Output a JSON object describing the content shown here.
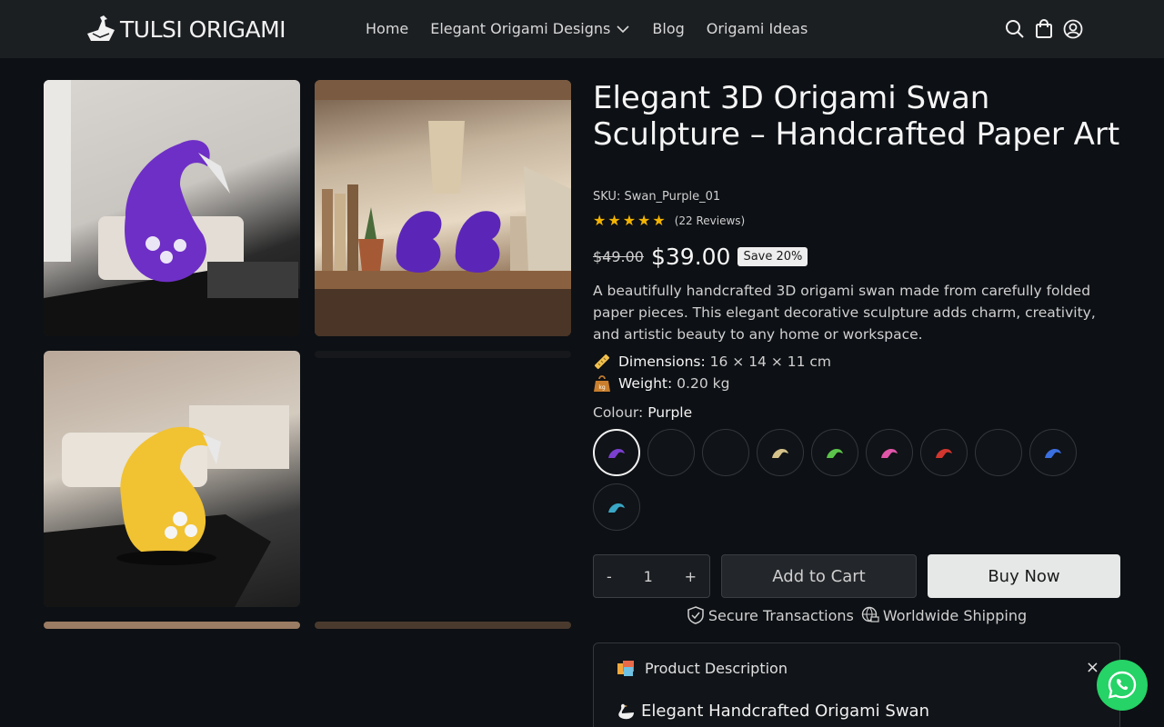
{
  "header": {
    "logo_text": "TULSI ORIGAMI",
    "nav": [
      {
        "label": "Home"
      },
      {
        "label": "Elegant Origami Designs",
        "has_dropdown": true
      },
      {
        "label": "Blog"
      },
      {
        "label": "Origami Ideas"
      }
    ],
    "icons": [
      "search-icon",
      "cart-bag-icon",
      "account-icon"
    ]
  },
  "gallery": {
    "images": [
      {
        "subject": "purple-swan-living-room"
      },
      {
        "subject": "two-purple-swans-shelf"
      },
      {
        "subject": "yellow-swan-table"
      },
      {
        "subject": "dark-partial"
      },
      {
        "subject": "partial"
      },
      {
        "subject": "partial"
      }
    ]
  },
  "product": {
    "title": "Elegant 3D Origami Swan Sculpture – Handcrafted Paper Art",
    "sku_label": "SKU:",
    "sku": "Swan_Purple_01",
    "rating_stars": 5,
    "reviews": "(22 Reviews)",
    "old_price": "$49.00",
    "price": "$39.00",
    "save_badge": "Save 20%",
    "description": "A beautifully handcrafted 3D origami swan made from carefully folded paper pieces. This elegant decorative sculpture adds charm, creativity, and artistic beauty to any home or workspace.",
    "dimensions_label": "Dimensions:",
    "dimensions_value": "16 × 14 × 11 cm",
    "weight_label": "Weight:",
    "weight_value": "0.20 kg",
    "colour_label": "Colour:",
    "colour_value": "Purple",
    "swatches": [
      {
        "color": "#7b3fd0",
        "selected": true
      },
      {
        "color": "",
        "selected": false
      },
      {
        "color": "",
        "selected": false
      },
      {
        "color": "#d4c28a",
        "selected": false
      },
      {
        "color": "#5cc44a",
        "selected": false
      },
      {
        "color": "#e056a8",
        "selected": false
      },
      {
        "color": "#d2362e",
        "selected": false
      },
      {
        "color": "",
        "selected": false
      },
      {
        "color": "#3b6fe0",
        "selected": false
      },
      {
        "color": "#3aa7c6",
        "selected": false
      }
    ],
    "quantity": {
      "minus": "-",
      "value": "1",
      "plus": "+"
    },
    "add_to_cart": "Add to Cart",
    "buy_now": "Buy Now",
    "trust": [
      "Secure Transactions",
      "Worldwide Shipping"
    ]
  },
  "accordion": {
    "title": "Product Description",
    "close": "×",
    "subheading": "Elegant Handcrafted Origami Swan"
  },
  "colors": {
    "background": "#0d1014",
    "header": "#1c1f22",
    "star": "#f4b400",
    "buy_button": "#e5e8e6",
    "whatsapp": "#25d366"
  }
}
